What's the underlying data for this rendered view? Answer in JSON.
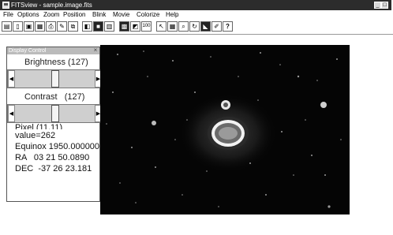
{
  "window": {
    "title": "FITSview - sample.image.fits",
    "controls": [
      "_",
      "□",
      "×"
    ]
  },
  "menu": [
    {
      "label": "File"
    },
    {
      "label": "Options"
    },
    {
      "label": "Zoom"
    },
    {
      "label": "Position"
    },
    {
      "label": "Blink"
    },
    {
      "label": "Movie"
    },
    {
      "label": "Colorize"
    },
    {
      "label": "Help"
    }
  ],
  "toolbar": {
    "icons": [
      "open-icon",
      "new-icon",
      "save-icon",
      "info-icon",
      "print-icon",
      "edit-icon",
      "copy-icon",
      "grayscale-icon",
      "contrast-icon",
      "colorbar-icon",
      "film-icon",
      "blink-icon",
      "zoom-100-icon",
      "pointer-icon",
      "histogram-icon",
      "magnify-icon",
      "refresh-icon",
      "invert-icon",
      "draw-icon",
      "help-icon"
    ],
    "zoom_label": "100",
    "help_label": "?"
  },
  "display_control": {
    "title": "Display Control",
    "brightness_label": "Brightness",
    "brightness_value": "(127)",
    "brightness_level": 0.5,
    "contrast_label": "Contrast",
    "contrast_value": "(127)",
    "contrast_level": 0.5
  },
  "pixel_info": {
    "pixel": "Pixel (11,11)",
    "value": "value=262",
    "equinox": "Equinox 1950.000000",
    "ra": "RA   03 21 50.0890",
    "dec": "DEC  -37 26 23.181"
  }
}
